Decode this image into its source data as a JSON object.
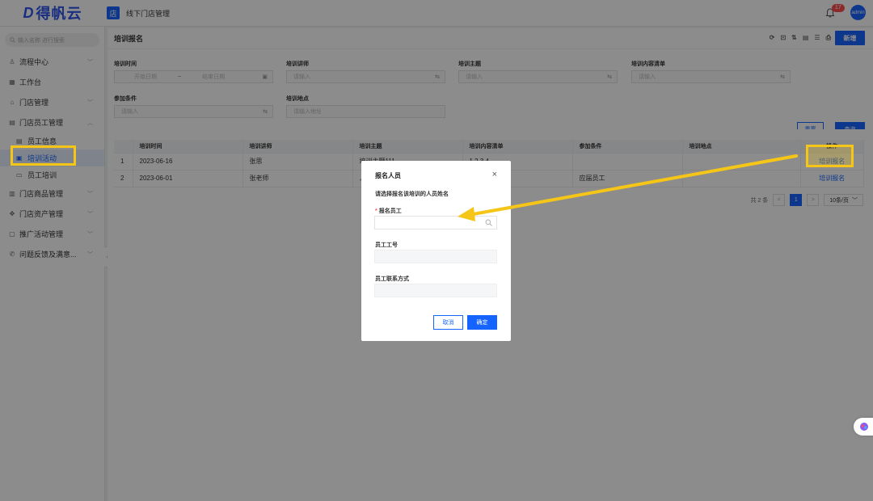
{
  "brand": {
    "logo_mark": "D",
    "logo_text": "得帆云"
  },
  "header": {
    "app_icon": "店",
    "app_title": "线下门店管理",
    "notif_count": "17",
    "avatar_text": "admin"
  },
  "sidebar": {
    "search_placeholder": "输入名称 进行搜索",
    "items": [
      {
        "label": "流程中心",
        "icon": "flow-icon"
      },
      {
        "label": "工作台",
        "icon": "grid-icon"
      },
      {
        "label": "门店管理",
        "icon": "home-icon"
      },
      {
        "label": "门店员工管理",
        "icon": "staff-icon"
      },
      {
        "label": "员工信息",
        "icon": "id-icon"
      },
      {
        "label": "培训活动",
        "icon": "calendar-icon"
      },
      {
        "label": "员工培训",
        "icon": "monitor-icon"
      },
      {
        "label": "门店商品管理",
        "icon": "box-icon"
      },
      {
        "label": "门店资产管理",
        "icon": "asset-icon"
      },
      {
        "label": "推广活动管理",
        "icon": "promo-icon"
      },
      {
        "label": "问题反馈及满意...",
        "icon": "phone-icon"
      }
    ]
  },
  "page": {
    "title": "培训报名",
    "new_button": "新增",
    "filters": {
      "time_label": "培训时间",
      "start_placeholder": "开始日期",
      "range_sep": "~",
      "end_placeholder": "结束日期",
      "teacher_label": "培训讲师",
      "teacher_placeholder": "请输入",
      "topic_label": "培训主题",
      "topic_placeholder": "请输入",
      "content_label": "培训内容清单",
      "content_placeholder": "请输入",
      "cond_label": "参加条件",
      "cond_placeholder": "请输入",
      "place_label": "培训地点",
      "place_placeholder": "请输入地址",
      "reset": "重置",
      "query": "查询"
    },
    "table": {
      "headers": [
        "",
        "培训时间",
        "培训讲师",
        "培训主题",
        "培训内容清单",
        "参加条件",
        "培训地点",
        "操作"
      ],
      "rows": [
        {
          "idx": "1",
          "date": "2023-06-16",
          "teacher": "张思",
          "topic": "培训主题111",
          "content": "1,2,3,4",
          "cond": "",
          "place": "",
          "op": "培训报名"
        },
        {
          "idx": "2",
          "date": "2023-06-01",
          "teacher": "张老师",
          "topic": "人",
          "content": "",
          "cond": "应届员工",
          "place": "",
          "op": "培训报名"
        }
      ]
    },
    "pager": {
      "total": "共 2 条",
      "prev": "<",
      "current": "1",
      "next": ">",
      "size": "10条/页"
    }
  },
  "modal": {
    "title": "报名人员",
    "close": "×",
    "desc": "请选择报名该培训的人员姓名",
    "required_mark": "*",
    "field1_label": "报名员工",
    "field2_label": "员工工号",
    "field3_label": "员工联系方式",
    "cancel": "取消",
    "ok": "确定"
  },
  "colors": {
    "primary": "#1664ff",
    "highlight": "#f5c518",
    "danger": "#ff4d4f"
  }
}
